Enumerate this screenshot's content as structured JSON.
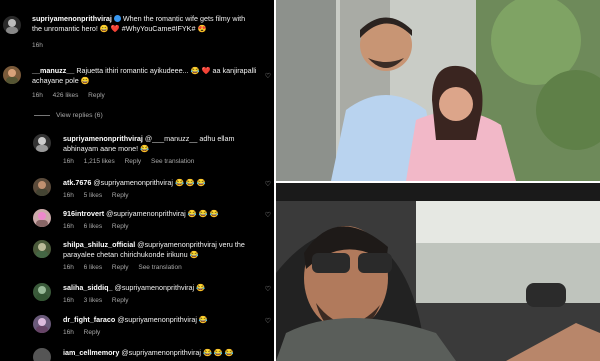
{
  "comments": [
    {
      "user": "supriyamenonprithviraj",
      "text": "When the romantic wife gets filmy with the unromantic hero! 😄 ❤️ #WhyYouCame#IFYK# 😍",
      "time": "16h",
      "likes": "",
      "reply": "",
      "translate": ""
    },
    {
      "user": "__manuzz__",
      "text": "Rajuetta ithiri romantic ayikudeee... 😂 ❤️ aa kanjirapalli achayane pole 😄",
      "time": "16h",
      "likes": "426 likes",
      "reply": "Reply",
      "translate": ""
    },
    {
      "user": "supriyamenonprithviraj",
      "text": "@___manuzz__ adhu ellam abhinayam aane mone! 😂",
      "time": "16h",
      "likes": "1,215 likes",
      "reply": "Reply",
      "translate": "See translation"
    },
    {
      "user": "atk.7676",
      "text": "@supriyamenonprithviraj 😂 😂 😂",
      "time": "16h",
      "likes": "5 likes",
      "reply": "Reply",
      "translate": ""
    },
    {
      "user": "916introvert",
      "text": "@supriyamenonprithviraj 😂 😂 😂",
      "time": "16h",
      "likes": "6 likes",
      "reply": "Reply",
      "translate": ""
    },
    {
      "user": "shilpa_shiluz_official",
      "text": "@supriyamenonprithviraj veru the parayalee chetan chirichukonde irikunu 😂",
      "time": "16h",
      "likes": "6 likes",
      "reply": "Reply",
      "translate": "See translation"
    },
    {
      "user": "saliha_siddiq_",
      "text": "@supriyamenonprithviraj 😂",
      "time": "16h",
      "likes": "3 likes",
      "reply": "Reply",
      "translate": ""
    },
    {
      "user": "dr_fight_faraco",
      "text": "@supriyamenonprithviraj 😂",
      "time": "16h",
      "likes": "",
      "reply": "Reply",
      "translate": ""
    },
    {
      "user": "iam_cellmemory",
      "text": "@supriyamenonprithviraj 😂 😂 😂",
      "time": "",
      "likes": "",
      "reply": "",
      "translate": ""
    }
  ],
  "view_replies": "View replies (6)",
  "colors": {
    "panel_bg": "#000000",
    "text": "#f2f2f2",
    "muted": "#a8a8a8"
  },
  "icons": [
    "heart-icon",
    "verified-icon"
  ]
}
